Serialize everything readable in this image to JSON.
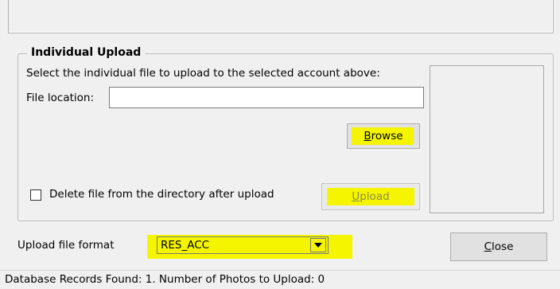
{
  "group": {
    "legend": "Individual Upload",
    "instructions": "Select the individual file to upload to the selected account above:",
    "file_location_label": "File location:",
    "file_location_value": "",
    "browse_label": "Browse",
    "delete_checkbox_label": "Delete file from the directory after upload",
    "delete_checked": false,
    "upload_label": "Upload"
  },
  "format": {
    "label": "Upload file format",
    "selected": "RES_ACC"
  },
  "close_label": "Close",
  "status": {
    "text": "Database Records Found: 1. Number of Photos to Upload: 0"
  },
  "colors": {
    "highlight": "#f5f500",
    "window_bg": "#f0f0f0",
    "disabled_text": "#8b8b4f"
  },
  "icons": {
    "dropdown": "chevron-down-icon"
  }
}
